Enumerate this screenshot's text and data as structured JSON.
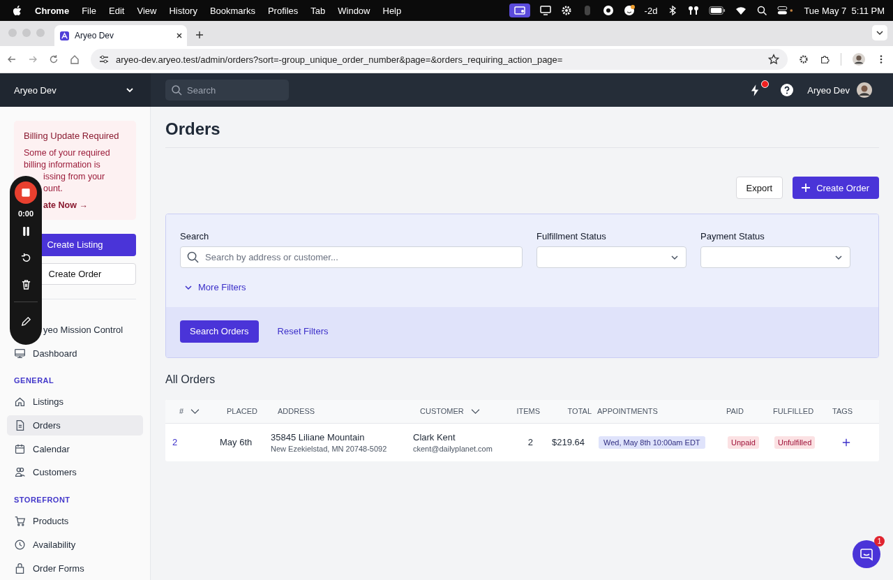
{
  "menubar": {
    "app": "Chrome",
    "menus": [
      "File",
      "Edit",
      "View",
      "History",
      "Bookmarks",
      "Profiles",
      "Tab",
      "Window",
      "Help"
    ],
    "status_text": "-2d",
    "clock": "Tue May 7  5:11 PM"
  },
  "browser": {
    "tab_title": "Aryeo Dev",
    "url": "aryeo-dev.aryeo.test/admin/orders?sort=-group_unique_order_number&page=&orders_requiring_action_page="
  },
  "header": {
    "workspace": "Aryeo Dev",
    "search_placeholder": "Search",
    "has_notification": true,
    "user": "Aryeo Dev"
  },
  "recorder": {
    "time": "0:00"
  },
  "sidebar": {
    "alert": {
      "title": "Billing Update Required",
      "text": "Some of your required billing information is",
      "cut_lines": [
        "issing from your",
        "ount."
      ],
      "link": "ate Now →"
    },
    "buttons": [
      {
        "label": "Create Listing",
        "primary": true
      },
      {
        "label": "Create Order",
        "primary": false
      }
    ],
    "sections": [
      {
        "items": [
          {
            "label": "yeo Mission Control",
            "selected": false
          },
          {
            "label": "Dashboard",
            "selected": false
          }
        ]
      },
      {
        "title": "GENERAL",
        "items": [
          {
            "label": "Listings",
            "selected": false
          },
          {
            "label": "Orders",
            "selected": true
          },
          {
            "label": "Calendar",
            "selected": false
          },
          {
            "label": "Customers",
            "selected": false
          }
        ]
      },
      {
        "title": "STOREFRONT",
        "items": [
          {
            "label": "Products",
            "selected": false
          },
          {
            "label": "Availability",
            "selected": false
          },
          {
            "label": "Order Forms",
            "selected": false
          }
        ]
      }
    ]
  },
  "page": {
    "title": "Orders",
    "buttons": [
      {
        "label": "Export",
        "primary": false
      },
      {
        "label": "Create Order",
        "primary": true
      }
    ]
  },
  "filters": {
    "fields": [
      {
        "label": "Search",
        "kind": "search",
        "placeholder": "Search by address or customer..."
      },
      {
        "label": "Fulfillment Status",
        "kind": "select"
      },
      {
        "label": "Payment Status",
        "kind": "select"
      }
    ],
    "more": "More Filters",
    "submit": "Search Orders",
    "reset": "Reset Filters"
  },
  "table": {
    "title": "All Orders",
    "columns": [
      {
        "label": "#",
        "sortable": true
      },
      {
        "label": "PLACED"
      },
      {
        "label": "ADDRESS"
      },
      {
        "label": "CUSTOMER",
        "sortable": true
      },
      {
        "label": "ITEMS"
      },
      {
        "label": "TOTAL"
      },
      {
        "label": "APPOINTMENTS"
      },
      {
        "label": "PAID"
      },
      {
        "label": "FULFILLED"
      },
      {
        "label": "TAGS"
      }
    ],
    "rows": [
      {
        "number": "2",
        "placed": "May 6th",
        "address": "35845 Liliane Mountain",
        "address_line2": "New Ezekielstad, MN 20748-5092",
        "customer": "Clark Kent",
        "email": "ckent@dailyplanet.com",
        "items": "2",
        "total": "$219.64",
        "appointment": "Wed, May 8th 10:00am EDT",
        "paid": "Unpaid",
        "fulfilled": "Unfulfilled"
      }
    ]
  },
  "chat": {
    "badge": "1"
  }
}
